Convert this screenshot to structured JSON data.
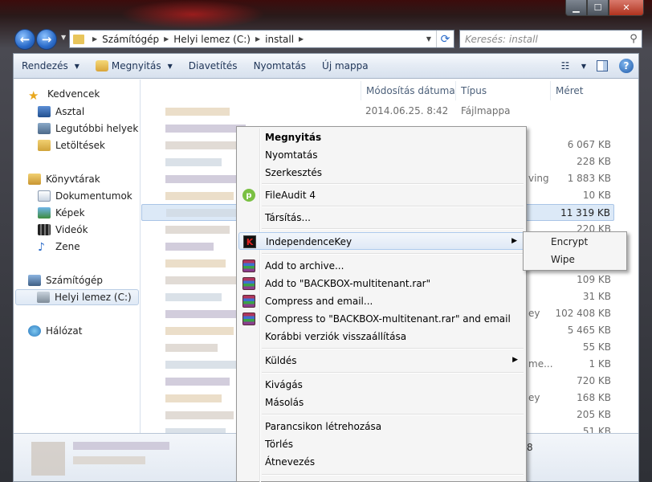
{
  "window": {
    "caption_buttons": [
      "minimize",
      "maximize",
      "close"
    ]
  },
  "address": {
    "crumbs": [
      "Számítógép",
      "Helyi lemez (C:)",
      "install"
    ],
    "search_placeholder": "Keresés: install"
  },
  "toolbar": {
    "organize": "Rendezés",
    "open": "Megnyitás",
    "slideshow": "Diavetítés",
    "print": "Nyomtatás",
    "new_folder": "Új mappa"
  },
  "nav": {
    "favorites": "Kedvencek",
    "desktop": "Asztal",
    "recent": "Legutóbbi helyek",
    "downloads": "Letöltések",
    "libraries": "Könyvtárak",
    "documents": "Dokumentumok",
    "pictures": "Képek",
    "videos": "Videók",
    "music": "Zene",
    "computer": "Számítógép",
    "local_disk": "Helyi lemez (C:)",
    "network": "Hálózat"
  },
  "columns": {
    "modified": "Módosítás dátuma",
    "type": "Típus",
    "size": "Méret"
  },
  "rows": [
    {
      "date": "2014.06.25. 8:42",
      "type": "Fájlmappa",
      "size": ""
    },
    {
      "date": "",
      "type": "",
      "size": ""
    },
    {
      "date": "",
      "type": "",
      "size": "6 067 KB"
    },
    {
      "date": "",
      "type": "",
      "size": "228 KB"
    },
    {
      "date": "",
      "type": "ving",
      "size": "1 883 KB"
    },
    {
      "date": "",
      "type": "",
      "size": "10 KB"
    },
    {
      "date": "",
      "type": "",
      "size": "11 319 KB"
    },
    {
      "date": "",
      "type": "",
      "size": "220 KB"
    },
    {
      "date": "",
      "type": "",
      "size": ""
    },
    {
      "date": "",
      "type": "",
      "size": ""
    },
    {
      "date": "",
      "type": "",
      "size": "109 KB"
    },
    {
      "date": "",
      "type": "",
      "size": "31 KB"
    },
    {
      "date": "",
      "type": "ey",
      "size": "102 408 KB"
    },
    {
      "date": "",
      "type": "",
      "size": "5 465 KB"
    },
    {
      "date": "",
      "type": "",
      "size": "55 KB"
    },
    {
      "date": "",
      "type": "me...",
      "size": "1 KB"
    },
    {
      "date": "",
      "type": "",
      "size": "720 KB"
    },
    {
      "date": "",
      "type": "ey",
      "size": "168 KB"
    },
    {
      "date": "",
      "type": "",
      "size": "205 KB"
    },
    {
      "date": "",
      "type": "",
      "size": "51 KB"
    }
  ],
  "status_fragment": "8",
  "context_menu": {
    "open": "Megnyitás",
    "print": "Nyomtatás",
    "edit": "Szerkesztés",
    "fileaudit": "FileAudit 4",
    "open_with": "Társítás...",
    "independencekey": "IndependenceKey",
    "add_archive": "Add to archive...",
    "add_rar": "Add to \"BACKBOX-multitenant.rar\"",
    "compress_email": "Compress and email...",
    "compress_rar_email": "Compress to \"BACKBOX-multitenant.rar\" and email",
    "restore_versions": "Korábbi verziók visszaállítása",
    "send_to": "Küldés",
    "cut": "Kivágás",
    "copy": "Másolás",
    "create_shortcut": "Parancsikon létrehozása",
    "delete": "Törlés",
    "rename": "Átnevezés"
  },
  "submenu": {
    "encrypt": "Encrypt",
    "wipe": "Wipe"
  }
}
